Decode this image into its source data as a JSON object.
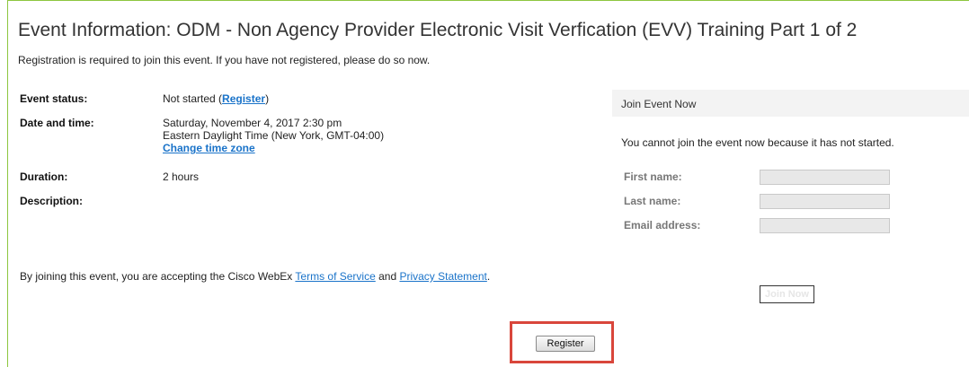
{
  "event": {
    "title": "Event Information: ODM - Non Agency Provider Electronic Visit Verfication (EVV) Training Part 1 of 2",
    "registration_note": "Registration is required to join this event. If you have not registered, please do so now."
  },
  "details": {
    "status_label": "Event status:",
    "status_value": "Not started (",
    "status_link": "Register",
    "status_close": ")",
    "datetime_label": "Date and time:",
    "datetime_line1": "Saturday, November 4, 2017 2:30 pm",
    "datetime_line2": "Eastern Daylight Time (New York, GMT-04:00)",
    "change_timezone_link": "Change time zone",
    "duration_label": "Duration:",
    "duration_value": "2 hours",
    "description_label": "Description:"
  },
  "join_panel": {
    "header": "Join Event Now",
    "message": "You cannot join the event now because it has not started.",
    "first_name_label": "First name:",
    "last_name_label": "Last name:",
    "email_label": "Email address:",
    "first_name_value": "",
    "last_name_value": "",
    "email_value": "",
    "join_button_label": "Join Now"
  },
  "terms": {
    "prefix": "By joining this event, you are accepting the Cisco WebEx ",
    "tos_link": "Terms of Service",
    "middle": " and ",
    "privacy_link": "Privacy Statement",
    "suffix": "."
  },
  "actions": {
    "register_button_label": "Register"
  },
  "colors": {
    "frame_border": "#8dc63f",
    "link": "#1a73c9",
    "highlight": "#d9463b"
  }
}
